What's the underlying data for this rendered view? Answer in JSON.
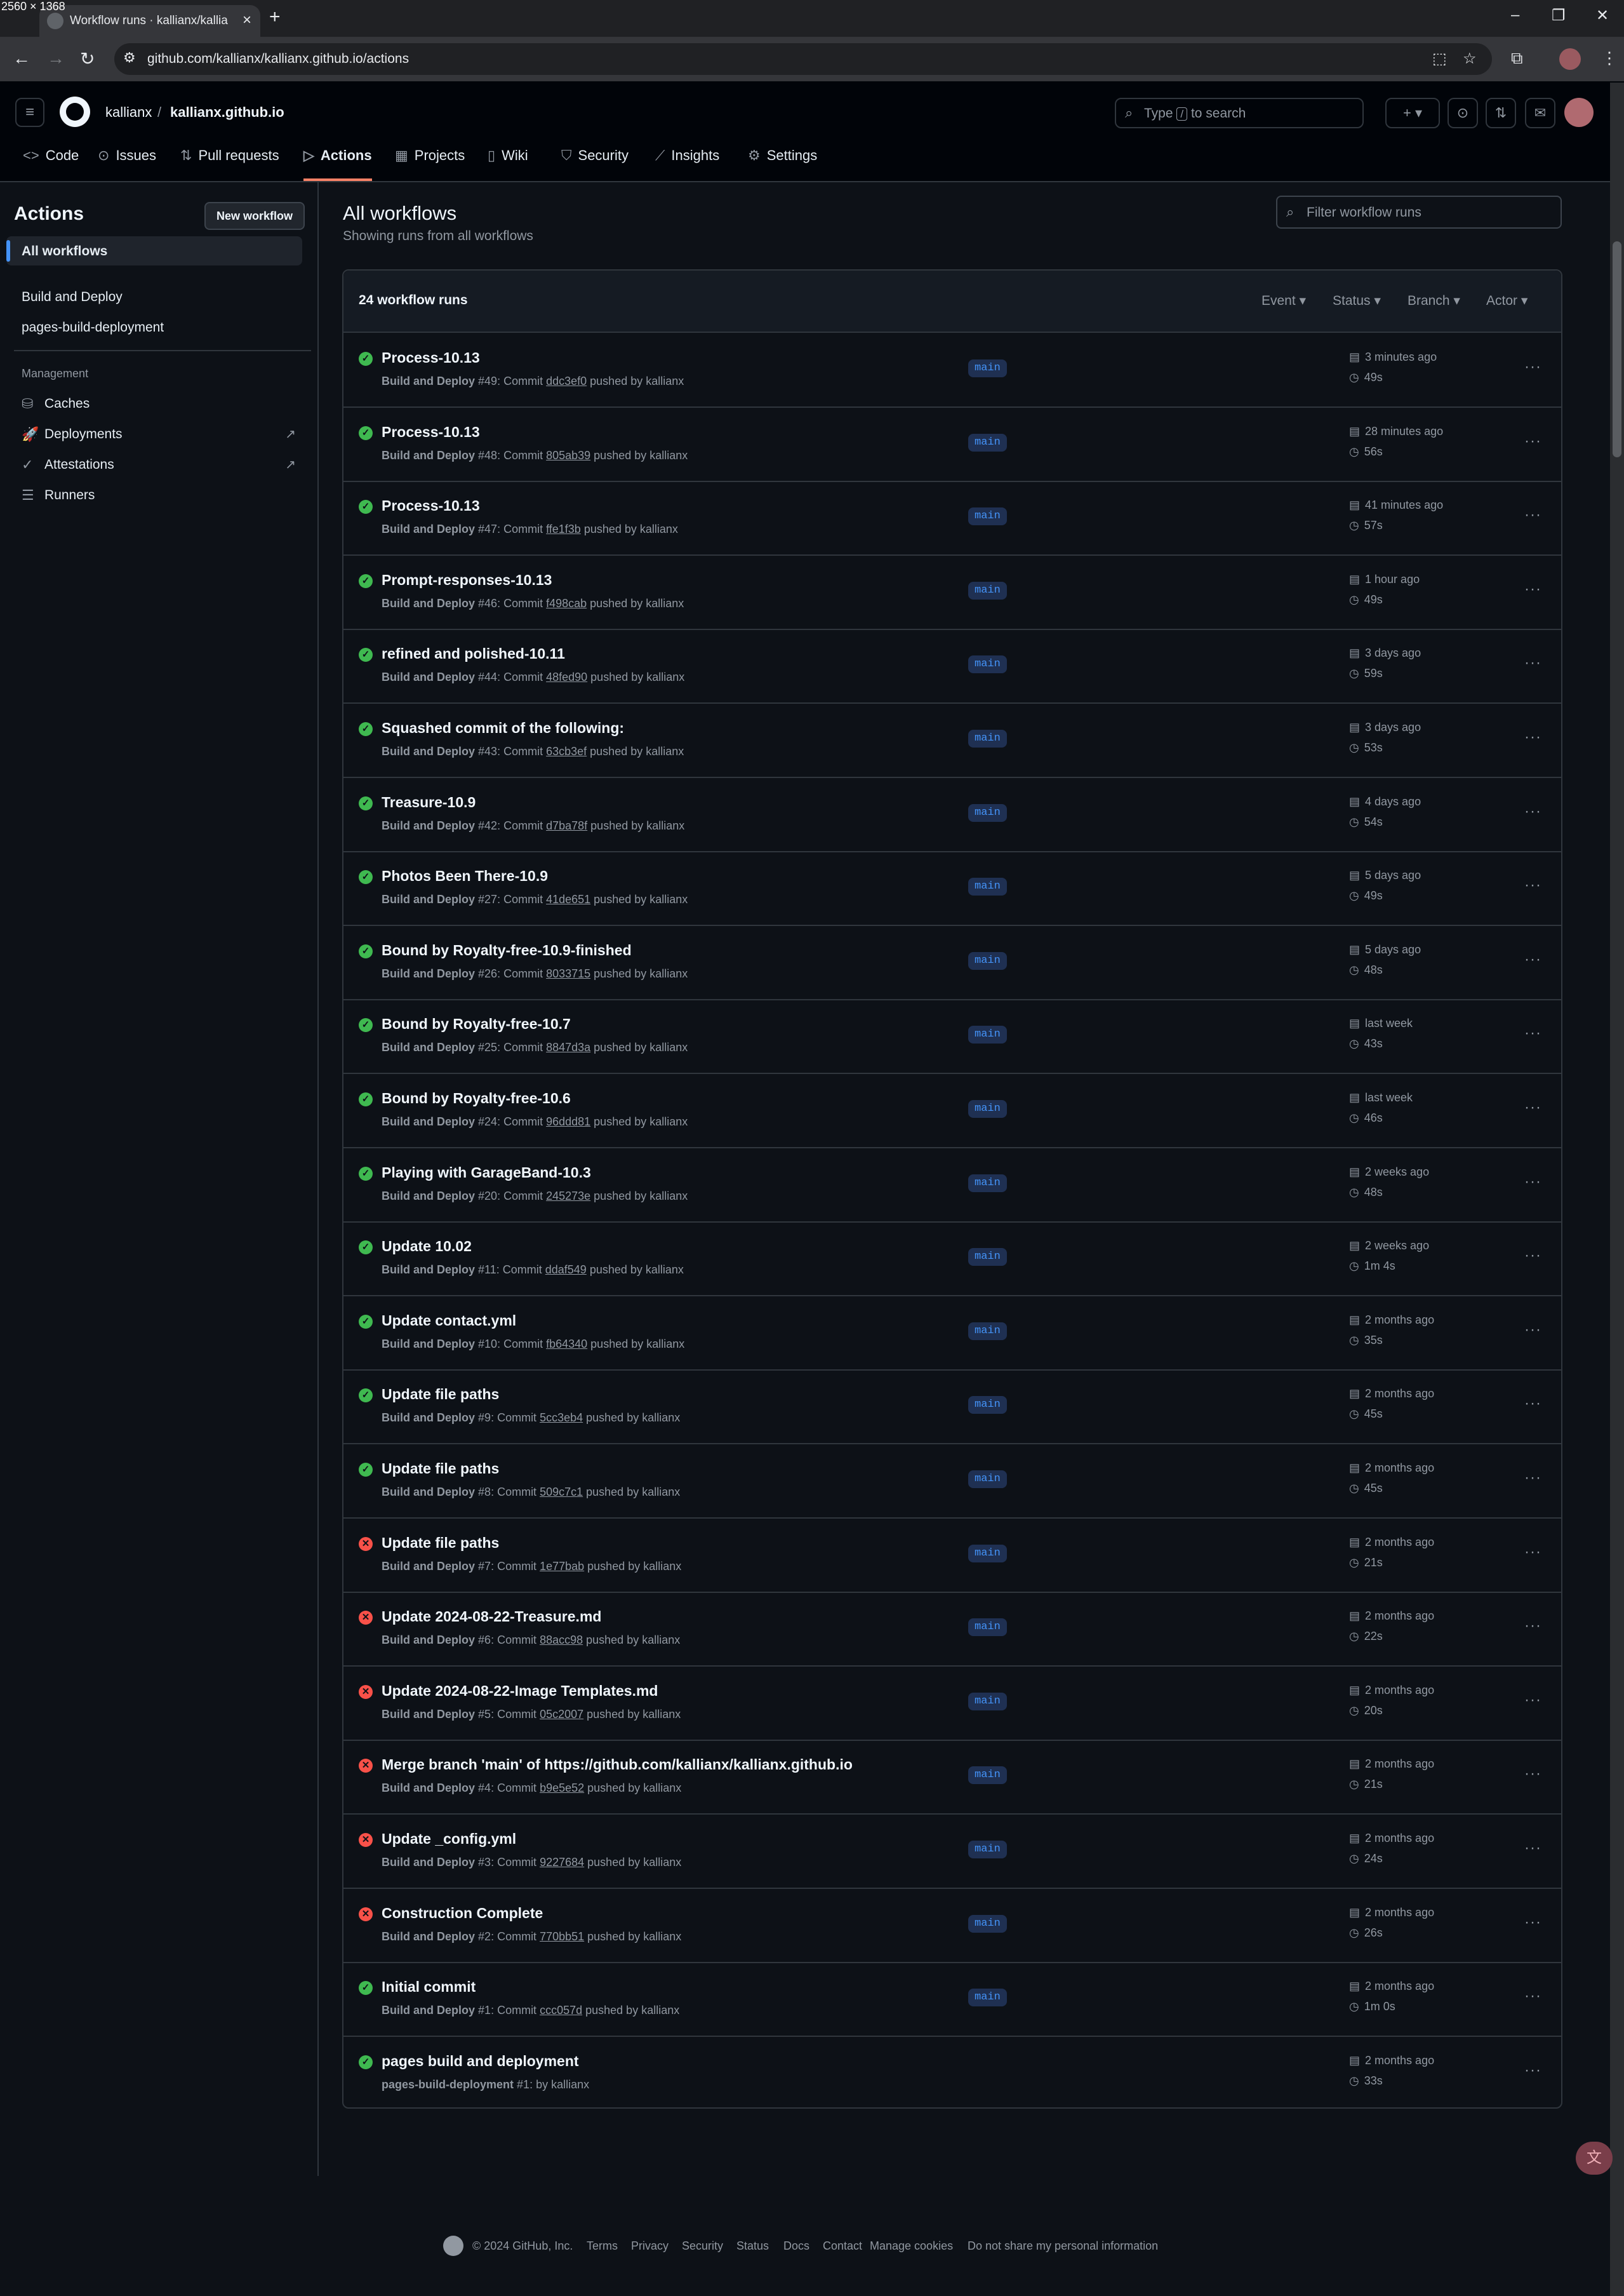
{
  "screen_label": "2560 × 1368",
  "browser": {
    "tab_title": "Workflow runs · kallianx/kallianx",
    "url": "github.com/kallianx/kallianx.github.io/actions"
  },
  "header": {
    "owner": "kallianx",
    "separator": "/",
    "repo": "kallianx.github.io",
    "search_prefix": "Type",
    "search_key": "/",
    "search_suffix": "to search"
  },
  "repo_nav": [
    {
      "label": "Code",
      "icon": "code-icon"
    },
    {
      "label": "Issues",
      "icon": "issue-icon"
    },
    {
      "label": "Pull requests",
      "icon": "pull-request-icon"
    },
    {
      "label": "Actions",
      "icon": "play-icon"
    },
    {
      "label": "Projects",
      "icon": "table-icon"
    },
    {
      "label": "Wiki",
      "icon": "book-icon"
    },
    {
      "label": "Security",
      "icon": "shield-icon"
    },
    {
      "label": "Insights",
      "icon": "graph-icon"
    },
    {
      "label": "Settings",
      "icon": "gear-icon"
    }
  ],
  "sidebar": {
    "title": "Actions",
    "new_workflow": "New workflow",
    "all_workflows": "All workflows",
    "workflows": [
      "Build and Deploy",
      "pages-build-deployment"
    ],
    "management_heading": "Management",
    "management": [
      {
        "label": "Caches",
        "icon": "database-icon"
      },
      {
        "label": "Deployments",
        "icon": "rocket-icon"
      },
      {
        "label": "Attestations",
        "icon": "verified-icon"
      },
      {
        "label": "Runners",
        "icon": "server-icon"
      }
    ]
  },
  "main": {
    "title": "All workflows",
    "subtitle": "Showing runs from all workflows",
    "filter_placeholder": "Filter workflow runs",
    "run_count": "24 workflow runs",
    "filters": [
      "Event",
      "Status",
      "Branch",
      "Actor"
    ]
  },
  "runs": [
    {
      "status": "success",
      "title": "Process-10.13",
      "workflow": "Build and Deploy",
      "run": "#49",
      "sha": "ddc3ef0",
      "actor": "kallianx",
      "branch": "main",
      "when": "3 minutes ago",
      "duration": "49s"
    },
    {
      "status": "success",
      "title": "Process-10.13",
      "workflow": "Build and Deploy",
      "run": "#48",
      "sha": "805ab39",
      "actor": "kallianx",
      "branch": "main",
      "when": "28 minutes ago",
      "duration": "56s"
    },
    {
      "status": "success",
      "title": "Process-10.13",
      "workflow": "Build and Deploy",
      "run": "#47",
      "sha": "ffe1f3b",
      "actor": "kallianx",
      "branch": "main",
      "when": "41 minutes ago",
      "duration": "57s"
    },
    {
      "status": "success",
      "title": "Prompt-responses-10.13",
      "workflow": "Build and Deploy",
      "run": "#46",
      "sha": "f498cab",
      "actor": "kallianx",
      "branch": "main",
      "when": "1 hour ago",
      "duration": "49s"
    },
    {
      "status": "success",
      "title": "refined and polished-10.11",
      "workflow": "Build and Deploy",
      "run": "#44",
      "sha": "48fed90",
      "actor": "kallianx",
      "branch": "main",
      "when": "3 days ago",
      "duration": "59s"
    },
    {
      "status": "success",
      "title": "Squashed commit of the following:",
      "workflow": "Build and Deploy",
      "run": "#43",
      "sha": "63cb3ef",
      "actor": "kallianx",
      "branch": "main",
      "when": "3 days ago",
      "duration": "53s"
    },
    {
      "status": "success",
      "title": "Treasure-10.9",
      "workflow": "Build and Deploy",
      "run": "#42",
      "sha": "d7ba78f",
      "actor": "kallianx",
      "branch": "main",
      "when": "4 days ago",
      "duration": "54s"
    },
    {
      "status": "success",
      "title": "Photos Been There-10.9",
      "workflow": "Build and Deploy",
      "run": "#27",
      "sha": "41de651",
      "actor": "kallianx",
      "branch": "main",
      "when": "5 days ago",
      "duration": "49s"
    },
    {
      "status": "success",
      "title": "Bound by Royalty-free-10.9-finished",
      "workflow": "Build and Deploy",
      "run": "#26",
      "sha": "8033715",
      "actor": "kallianx",
      "branch": "main",
      "when": "5 days ago",
      "duration": "48s"
    },
    {
      "status": "success",
      "title": "Bound by Royalty-free-10.7",
      "workflow": "Build and Deploy",
      "run": "#25",
      "sha": "8847d3a",
      "actor": "kallianx",
      "branch": "main",
      "when": "last week",
      "duration": "43s"
    },
    {
      "status": "success",
      "title": "Bound by Royalty-free-10.6",
      "workflow": "Build and Deploy",
      "run": "#24",
      "sha": "96ddd81",
      "actor": "kallianx",
      "branch": "main",
      "when": "last week",
      "duration": "46s"
    },
    {
      "status": "success",
      "title": "Playing with GarageBand-10.3",
      "workflow": "Build and Deploy",
      "run": "#20",
      "sha": "245273e",
      "actor": "kallianx",
      "branch": "main",
      "when": "2 weeks ago",
      "duration": "48s"
    },
    {
      "status": "success",
      "title": "Update 10.02",
      "workflow": "Build and Deploy",
      "run": "#11",
      "sha": "ddaf549",
      "actor": "kallianx",
      "branch": "main",
      "when": "2 weeks ago",
      "duration": "1m 4s"
    },
    {
      "status": "success",
      "title": "Update contact.yml",
      "workflow": "Build and Deploy",
      "run": "#10",
      "sha": "fb64340",
      "actor": "kallianx",
      "branch": "main",
      "when": "2 months ago",
      "duration": "35s"
    },
    {
      "status": "success",
      "title": "Update file paths",
      "workflow": "Build and Deploy",
      "run": "#9",
      "sha": "5cc3eb4",
      "actor": "kallianx",
      "branch": "main",
      "when": "2 months ago",
      "duration": "45s"
    },
    {
      "status": "success",
      "title": "Update file paths",
      "workflow": "Build and Deploy",
      "run": "#8",
      "sha": "509c7c1",
      "actor": "kallianx",
      "branch": "main",
      "when": "2 months ago",
      "duration": "45s"
    },
    {
      "status": "failure",
      "title": "Update file paths",
      "workflow": "Build and Deploy",
      "run": "#7",
      "sha": "1e77bab",
      "actor": "kallianx",
      "branch": "main",
      "when": "2 months ago",
      "duration": "21s"
    },
    {
      "status": "failure",
      "title": "Update 2024-08-22-Treasure.md",
      "workflow": "Build and Deploy",
      "run": "#6",
      "sha": "88acc98",
      "actor": "kallianx",
      "branch": "main",
      "when": "2 months ago",
      "duration": "22s"
    },
    {
      "status": "failure",
      "title": "Update 2024-08-22-Image Templates.md",
      "workflow": "Build and Deploy",
      "run": "#5",
      "sha": "05c2007",
      "actor": "kallianx",
      "branch": "main",
      "when": "2 months ago",
      "duration": "20s"
    },
    {
      "status": "failure",
      "title": "Merge branch 'main' of https://github.com/kallianx/kallianx.github.io",
      "workflow": "Build and Deploy",
      "run": "#4",
      "sha": "b9e5e52",
      "actor": "kallianx",
      "branch": "main",
      "when": "2 months ago",
      "duration": "21s"
    },
    {
      "status": "failure",
      "title": "Update _config.yml",
      "workflow": "Build and Deploy",
      "run": "#3",
      "sha": "9227684",
      "actor": "kallianx",
      "branch": "main",
      "when": "2 months ago",
      "duration": "24s"
    },
    {
      "status": "failure",
      "title": "Construction Complete",
      "workflow": "Build and Deploy",
      "run": "#2",
      "sha": "770bb51",
      "actor": "kallianx",
      "branch": "main",
      "when": "2 months ago",
      "duration": "26s"
    },
    {
      "status": "success",
      "title": "Initial commit",
      "workflow": "Build and Deploy",
      "run": "#1",
      "sha": "ccc057d",
      "actor": "kallianx",
      "branch": "main",
      "when": "2 months ago",
      "duration": "1m 0s"
    },
    {
      "status": "success",
      "title": "pages build and deployment",
      "workflow": "pages-build-deployment",
      "run": "#1",
      "sha": "",
      "actor": "kallianx",
      "branch": "",
      "when": "2 months ago",
      "duration": "33s"
    }
  ],
  "run_meta": {
    "commit_word": "Commit",
    "pushed_by": "pushed by",
    "by": "by"
  },
  "footer": {
    "copyright": "© 2024 GitHub, Inc.",
    "links": [
      "Terms",
      "Privacy",
      "Security",
      "Status",
      "Docs",
      "Contact",
      "Manage cookies",
      "Do not share my personal information"
    ]
  },
  "colors": {
    "success": "#3fb950",
    "failure": "#f85149",
    "accent": "#4493f8",
    "active_tab": "#f78166"
  }
}
